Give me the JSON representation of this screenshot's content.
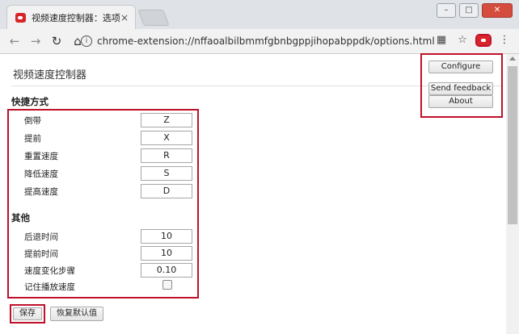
{
  "browser": {
    "tab_title": "视频速度控制器：选项",
    "tab_close": "×",
    "url": "chrome-extension://nffaoalbilbmmfgbnbgppjihopabppdk/options.html",
    "window_controls": [
      "–",
      "□",
      "✕"
    ]
  },
  "page": {
    "title": "视频速度控制器",
    "shortcuts_label": "快捷方式",
    "shortcuts": [
      {
        "label": "倒带",
        "key": "Z"
      },
      {
        "label": "提前",
        "key": "X"
      },
      {
        "label": "重置速度",
        "key": "R"
      },
      {
        "label": "降低速度",
        "key": "S"
      },
      {
        "label": "提高速度",
        "key": "D"
      }
    ],
    "other_label": "其他",
    "other": [
      {
        "label": "后退时间",
        "value": "10"
      },
      {
        "label": "提前时间",
        "value": "10"
      },
      {
        "label": "速度变化步骤",
        "value": "0.10"
      }
    ],
    "remember_label": "记住播放速度",
    "remember_checked": false,
    "save_button": "保存",
    "restore_button": "恢复默认值"
  },
  "sidebar_buttons": {
    "configure": "Configure",
    "send_feedback": "Send feedback",
    "about": "About"
  },
  "colors": {
    "highlight": "#c0102a",
    "extension_icon": "#d9252a"
  }
}
